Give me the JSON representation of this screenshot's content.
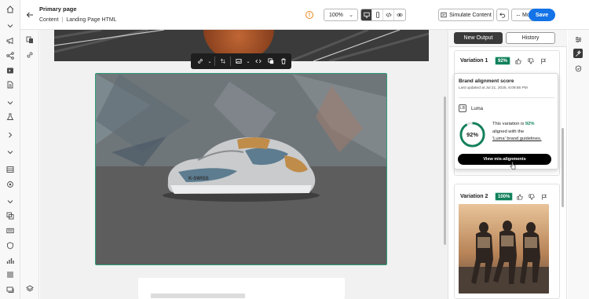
{
  "header": {
    "title": "Primary page",
    "breadcrumb": [
      "Content",
      "Landing Page HTML"
    ],
    "zoom": "100%",
    "simulate_label": "Simulate Content",
    "more_label": "More",
    "save_label": "Save",
    "view_icons": [
      "desktop-icon",
      "mobile-icon",
      "code-icon",
      "preview-icon"
    ]
  },
  "panel": {
    "tabs": [
      "New Output",
      "History"
    ],
    "variation1": {
      "title": "Variation 1",
      "score": "92%"
    },
    "variation2": {
      "title": "Variation 2",
      "score": "100%"
    }
  },
  "popover": {
    "heading": "Brand alignment score",
    "updated": "Last updated at Jul 21, 2025, 6:09:56 PM",
    "brand": "Luma",
    "score": "92%",
    "score_value": 0.92,
    "text_prefix": "This variation is",
    "text_score": "92%",
    "text_middle": "aligned with the",
    "text_link": "'Luma' brand guidelines.",
    "button": "View mis-alignments"
  },
  "colors": {
    "accent": "#1473e6",
    "success": "#12805c",
    "selection": "#2d9d78"
  }
}
